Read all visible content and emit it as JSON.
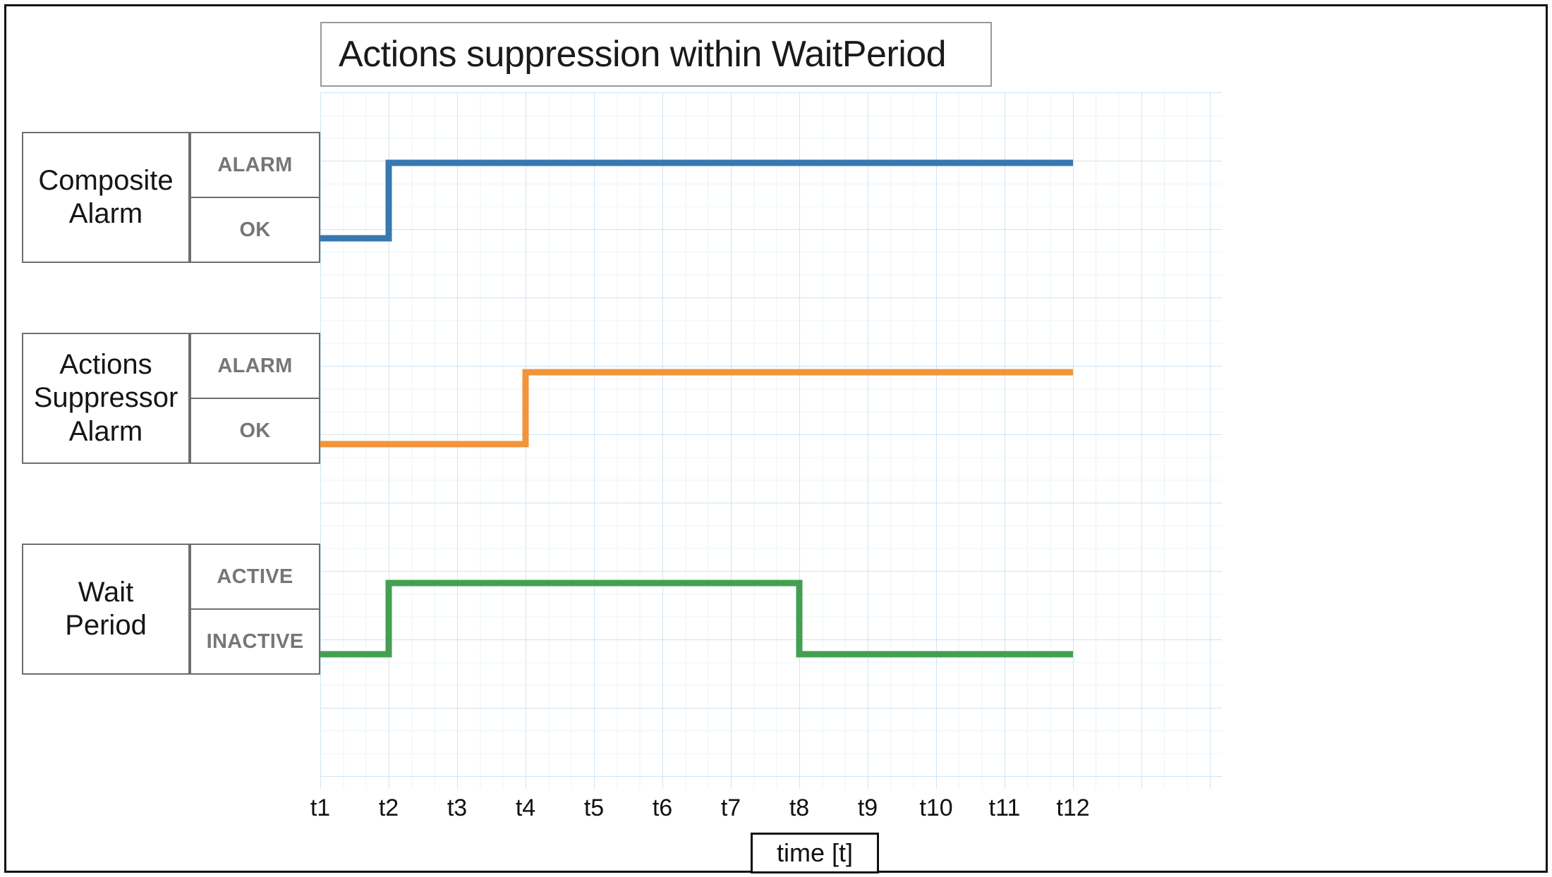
{
  "chart": {
    "title": "Actions suppression within WaitPeriod",
    "x_axis_label": "time [t]"
  },
  "rows": [
    {
      "name": "Composite\nAlarm",
      "name_line1": "Composite",
      "name_line2": "Alarm",
      "high_label": "ALARM",
      "low_label": "OK"
    },
    {
      "name": "Actions Suppressor Alarm",
      "name_line1": "Actions",
      "name_line2": "Suppressor",
      "name_line3": "Alarm",
      "high_label": "ALARM",
      "low_label": "OK"
    },
    {
      "name": "Wait Period",
      "name_line1": "Wait",
      "name_line2": "Period",
      "high_label": "ACTIVE",
      "low_label": "INACTIVE"
    }
  ],
  "chart_data": {
    "type": "line",
    "title": "Actions suppression within WaitPeriod",
    "xlabel": "time [t]",
    "ylabel": "",
    "grid": true,
    "legend_position": "none",
    "x": [
      "t1",
      "t2",
      "t3",
      "t4",
      "t5",
      "t6",
      "t7",
      "t8",
      "t9",
      "t10",
      "t11",
      "t12"
    ],
    "xlim": [
      "t0",
      "t13"
    ],
    "tick_labels": [
      "t1",
      "t2",
      "t3",
      "t4",
      "t5",
      "t6",
      "t7",
      "t8",
      "t9",
      "t10",
      "t11",
      "t12"
    ],
    "series": [
      {
        "name": "Composite Alarm",
        "color": "#3778B0",
        "states": [
          "OK",
          "ALARM"
        ],
        "step_type": "post",
        "transitions": [
          {
            "at": "t2",
            "from": "OK",
            "to": "ALARM"
          }
        ],
        "values": [
          "OK",
          "ALARM",
          "ALARM",
          "ALARM",
          "ALARM",
          "ALARM",
          "ALARM",
          "ALARM",
          "ALARM",
          "ALARM",
          "ALARM",
          "ALARM"
        ]
      },
      {
        "name": "Actions Suppressor Alarm",
        "color": "#F1943A",
        "states": [
          "OK",
          "ALARM"
        ],
        "step_type": "post",
        "transitions": [
          {
            "at": "t4",
            "from": "OK",
            "to": "ALARM"
          }
        ],
        "values": [
          "OK",
          "OK",
          "OK",
          "ALARM",
          "ALARM",
          "ALARM",
          "ALARM",
          "ALARM",
          "ALARM",
          "ALARM",
          "ALARM",
          "ALARM"
        ]
      },
      {
        "name": "Wait Period",
        "color": "#44A051",
        "states": [
          "INACTIVE",
          "ACTIVE"
        ],
        "step_type": "post",
        "transitions": [
          {
            "at": "t2",
            "from": "INACTIVE",
            "to": "ACTIVE"
          },
          {
            "at": "t8",
            "from": "ACTIVE",
            "to": "INACTIVE"
          }
        ],
        "values": [
          "INACTIVE",
          "ACTIVE",
          "ACTIVE",
          "ACTIVE",
          "ACTIVE",
          "ACTIVE",
          "ACTIVE",
          "INACTIVE",
          "INACTIVE",
          "INACTIVE",
          "INACTIVE",
          "INACTIVE"
        ]
      }
    ]
  }
}
